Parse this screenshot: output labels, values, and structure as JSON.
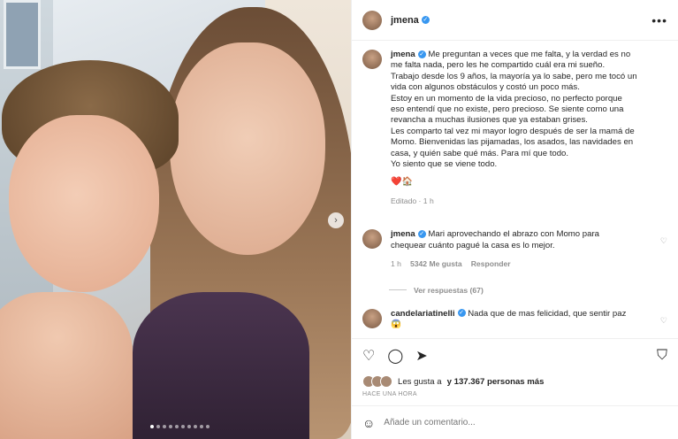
{
  "post": {
    "username": "jmena",
    "more_icon": "more-horizontal-icon",
    "caption_lines": [
      "Me preguntan a veces que me falta, y la verdad es no",
      "me falta nada, pero les he compartido cuál era mi sueño.",
      "Trabajo desde los 9 años, la mayoría ya lo sabe, pero me tocó un",
      "vida con algunos obstáculos y costó un poco más.",
      "Estoy en un momento de la vida precioso, no perfecto porque",
      "eso entendí que no existe, pero precioso. Se siente como una",
      "revancha a muchas ilusiones que ya estaban grises.",
      "Les comparto tal vez mi mayor logro después de ser la mamá de",
      "Momo. Bienvenidas las pijamadas, los asados, las navidades en",
      "casa, y quién sabe qué más. Para mí que todo.",
      "Yo siento que se viene todo."
    ],
    "emojis": "❤️🏠",
    "edited": "Editado · 1 h"
  },
  "comments": [
    {
      "username": "jmena",
      "text_lines": [
        "Mari aprovechando el abrazo con Momo para",
        "chequear cuánto pagué la casa es lo mejor."
      ],
      "time": "1 h",
      "likes": "5342 Me gusta",
      "reply": "Responder",
      "view_replies": "Ver respuestas (67)"
    },
    {
      "username": "candelariatinelli",
      "text_lines": [
        "Nada que de mas felicidad, que sentir paz",
        "😱"
      ]
    }
  ],
  "likes_text": {
    "prefix": "Les gusta a",
    "suffix": "y 137.367 personas más"
  },
  "timestamp": "HACE UNA HORA",
  "add_comment": {
    "placeholder": "Añade un comentario..."
  }
}
